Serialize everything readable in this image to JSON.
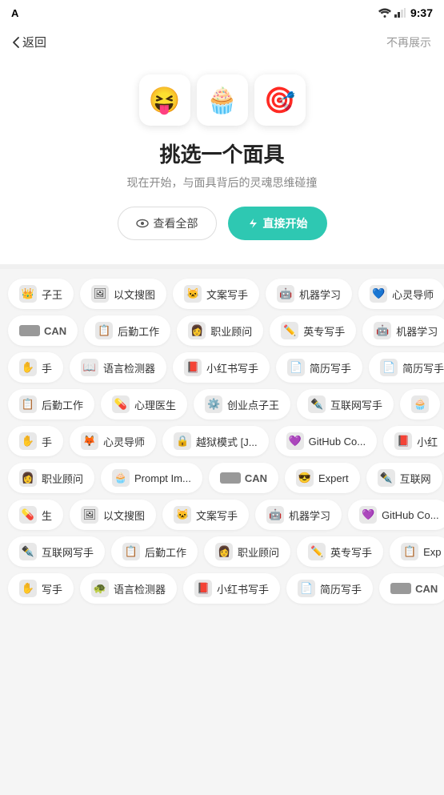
{
  "statusBar": {
    "time": "9:37",
    "appIcon": "A"
  },
  "nav": {
    "backLabel": "返回",
    "noShowLabel": "不再展示"
  },
  "hero": {
    "emojis": [
      "😝",
      "🧁",
      "🎯"
    ],
    "title": "挑选一个面具",
    "subtitle": "现在开始，与面具背后的灵魂思维碰撞",
    "btnViewAll": "查看全部",
    "btnStart": "直接开始"
  },
  "rows": [
    [
      {
        "icon": "👑",
        "label": "子王"
      },
      {
        "icon": "🖼",
        "label": "以文搜图"
      },
      {
        "icon": "🐱",
        "label": "文案写手"
      },
      {
        "icon": "🤖",
        "label": "机器学习"
      },
      {
        "icon": "💙",
        "label": "心灵导师"
      }
    ],
    [
      {
        "isCan": true,
        "label": "CAN"
      },
      {
        "icon": "📋",
        "label": "后勤工作"
      },
      {
        "icon": "👩",
        "label": "职业顾问"
      },
      {
        "icon": "✏️",
        "label": "英专写手"
      },
      {
        "icon": "🤖",
        "label": "机器学习"
      }
    ],
    [
      {
        "icon": "✋",
        "label": "手"
      },
      {
        "icon": "📖",
        "label": "语言检测器"
      },
      {
        "icon": "📕",
        "label": "小红书写手"
      },
      {
        "icon": "📄",
        "label": "简历写手"
      },
      {
        "icon": "📄",
        "label": "简历写手"
      }
    ],
    [
      {
        "icon": "📋",
        "label": "后勤工作"
      },
      {
        "icon": "💊",
        "label": "心理医生"
      },
      {
        "icon": "⚙️",
        "label": "创业点子王"
      },
      {
        "icon": "✒️",
        "label": "互联网写手"
      },
      {
        "icon": "🧁",
        "label": ""
      }
    ],
    [
      {
        "icon": "✋",
        "label": "手"
      },
      {
        "icon": "🦊",
        "label": "心灵导师"
      },
      {
        "icon": "🔒",
        "label": "越狱模式 [J..."
      },
      {
        "icon": "💜",
        "label": "GitHub Co..."
      },
      {
        "icon": "📕",
        "label": "小红"
      }
    ],
    [
      {
        "icon": "👩",
        "label": "职业顾问"
      },
      {
        "icon": "🧁",
        "label": "Prompt Im..."
      },
      {
        "isCan": true,
        "label": "CAN"
      },
      {
        "icon": "😎",
        "label": "Expert"
      },
      {
        "icon": "✒️",
        "label": "互联网"
      }
    ],
    [
      {
        "icon": "💊",
        "label": "生"
      },
      {
        "icon": "🖼",
        "label": "以文搜图"
      },
      {
        "icon": "🐱",
        "label": "文案写手"
      },
      {
        "icon": "🤖",
        "label": "机器学习"
      },
      {
        "icon": "💜",
        "label": "GitHub Co..."
      }
    ],
    [
      {
        "icon": "✒️",
        "label": "互联网写手"
      },
      {
        "icon": "📋",
        "label": "后勤工作"
      },
      {
        "icon": "👩",
        "label": "职业顾问"
      },
      {
        "icon": "✏️",
        "label": "英专写手"
      },
      {
        "icon": "📋",
        "label": "Exp"
      }
    ],
    [
      {
        "icon": "✋",
        "label": "写手"
      },
      {
        "icon": "🐢",
        "label": "语言检测器"
      },
      {
        "icon": "📕",
        "label": "小红书写手"
      },
      {
        "icon": "📄",
        "label": "简历写手"
      },
      {
        "isCan": true,
        "label": "CAN"
      }
    ]
  ]
}
